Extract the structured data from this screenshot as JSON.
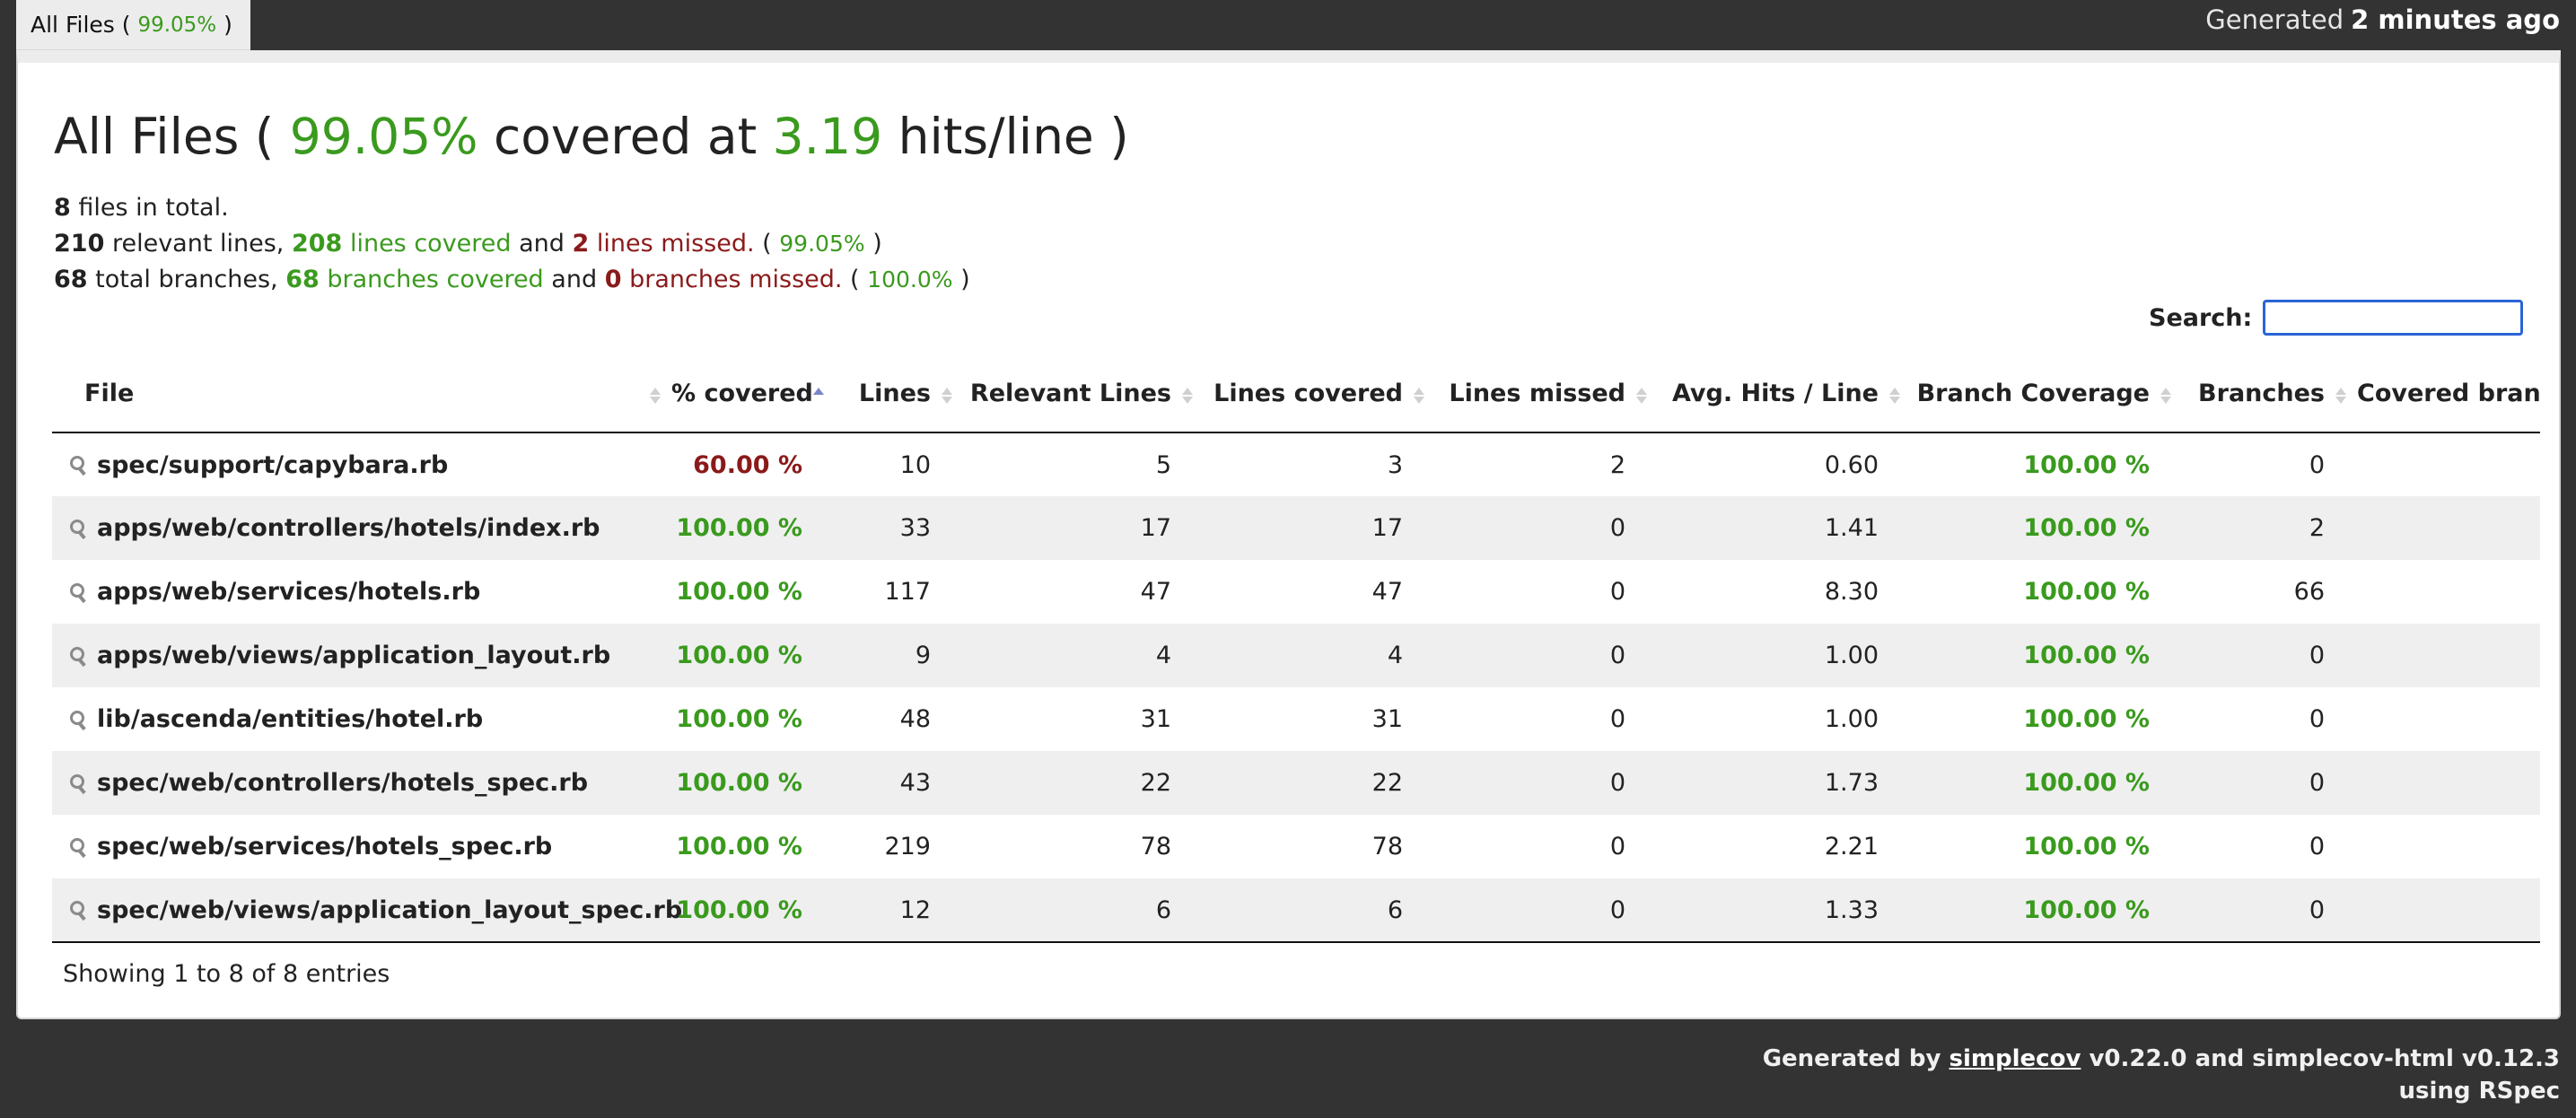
{
  "tab": {
    "label": "All Files (",
    "percent": "99.05%",
    "close": ")"
  },
  "timestamp": {
    "prefix": "Generated",
    "value": "2 minutes ago"
  },
  "title": {
    "prefix": "All Files (",
    "percent": "99.05%",
    "middle": "covered at",
    "hits": "3.19",
    "suffix": "hits/line )"
  },
  "summary": {
    "files_count": "8",
    "files_text": "files in total.",
    "relevant_lines": "210",
    "relevant_text": "relevant lines,",
    "lines_covered": "208",
    "lines_covered_text": "lines covered",
    "and1": "and",
    "lines_missed": "2",
    "lines_missed_text": "lines missed.",
    "lines_pct": "99.05%",
    "total_branches": "68",
    "branches_text": "total branches,",
    "branches_covered": "68",
    "branches_covered_text": "branches covered",
    "and2": "and",
    "branches_missed": "0",
    "branches_missed_text": "branches missed.",
    "branches_pct": "100.0%"
  },
  "search": {
    "label": "Search:",
    "value": ""
  },
  "table": {
    "headers": [
      "File",
      "% covered",
      "Lines",
      "Relevant Lines",
      "Lines covered",
      "Lines missed",
      "Avg. Hits / Line",
      "Branch Coverage",
      "Branches",
      "Covered branches"
    ],
    "rows": [
      {
        "file": "spec/support/capybara.rb",
        "covered": "60.00 %",
        "lines": "10",
        "relevant": "5",
        "lines_covered": "3",
        "missed": "2",
        "avg": "0.60",
        "branch_cov": "100.00 %",
        "branches": "0",
        "covered_branches": ""
      },
      {
        "file": "apps/web/controllers/hotels/index.rb",
        "covered": "100.00 %",
        "lines": "33",
        "relevant": "17",
        "lines_covered": "17",
        "missed": "0",
        "avg": "1.41",
        "branch_cov": "100.00 %",
        "branches": "2",
        "covered_branches": ""
      },
      {
        "file": "apps/web/services/hotels.rb",
        "covered": "100.00 %",
        "lines": "117",
        "relevant": "47",
        "lines_covered": "47",
        "missed": "0",
        "avg": "8.30",
        "branch_cov": "100.00 %",
        "branches": "66",
        "covered_branches": ""
      },
      {
        "file": "apps/web/views/application_layout.rb",
        "covered": "100.00 %",
        "lines": "9",
        "relevant": "4",
        "lines_covered": "4",
        "missed": "0",
        "avg": "1.00",
        "branch_cov": "100.00 %",
        "branches": "0",
        "covered_branches": ""
      },
      {
        "file": "lib/ascenda/entities/hotel.rb",
        "covered": "100.00 %",
        "lines": "48",
        "relevant": "31",
        "lines_covered": "31",
        "missed": "0",
        "avg": "1.00",
        "branch_cov": "100.00 %",
        "branches": "0",
        "covered_branches": ""
      },
      {
        "file": "spec/web/controllers/hotels_spec.rb",
        "covered": "100.00 %",
        "lines": "43",
        "relevant": "22",
        "lines_covered": "22",
        "missed": "0",
        "avg": "1.73",
        "branch_cov": "100.00 %",
        "branches": "0",
        "covered_branches": ""
      },
      {
        "file": "spec/web/services/hotels_spec.rb",
        "covered": "100.00 %",
        "lines": "219",
        "relevant": "78",
        "lines_covered": "78",
        "missed": "0",
        "avg": "2.21",
        "branch_cov": "100.00 %",
        "branches": "0",
        "covered_branches": ""
      },
      {
        "file": "spec/web/views/application_layout_spec.rb",
        "covered": "100.00 %",
        "lines": "12",
        "relevant": "6",
        "lines_covered": "6",
        "missed": "0",
        "avg": "1.33",
        "branch_cov": "100.00 %",
        "branches": "0",
        "covered_branches": ""
      }
    ],
    "info": "Showing 1 to 8 of 8 entries"
  },
  "footer": {
    "generated_by": "Generated by",
    "link": "simplecov",
    "versions": "v0.22.0 and simplecov-html v0.12.3",
    "using": "using RSpec"
  },
  "colors": {
    "covered_green": "#3a9a1e",
    "missed_red": "#8b1a1a",
    "background": "#333333",
    "row_alt": "#efefef"
  }
}
